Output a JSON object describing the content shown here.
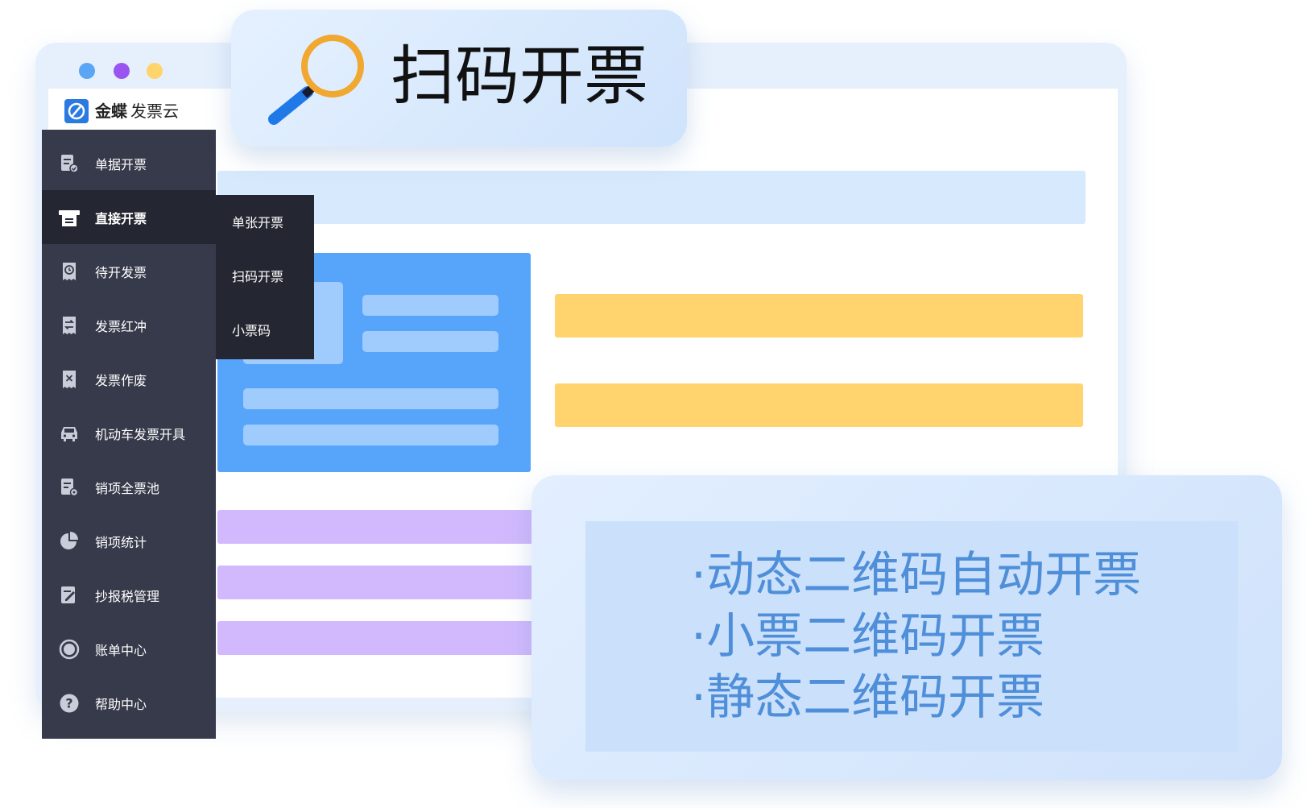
{
  "banner": {
    "title": "扫码开票"
  },
  "app": {
    "logo_brand": "金蝶",
    "logo_product": "发票云"
  },
  "sidebar": {
    "items": [
      {
        "label": "单据开票",
        "icon": "document-check-icon"
      },
      {
        "label": "直接开票",
        "icon": "printer-icon",
        "active": true
      },
      {
        "label": "待开发票",
        "icon": "clock-receipt-icon"
      },
      {
        "label": "发票红冲",
        "icon": "swap-receipt-icon"
      },
      {
        "label": "发票作废",
        "icon": "void-receipt-icon"
      },
      {
        "label": "机动车发票开具",
        "icon": "car-icon"
      },
      {
        "label": "销项全票池",
        "icon": "document-gear-icon"
      },
      {
        "label": "销项统计",
        "icon": "pie-chart-icon"
      },
      {
        "label": "抄报税管理",
        "icon": "edit-document-icon"
      },
      {
        "label": "账单中心",
        "icon": "circle-icon"
      },
      {
        "label": "帮助中心",
        "icon": "help-icon"
      }
    ]
  },
  "submenu": {
    "items": [
      "单张开票",
      "扫码开票",
      "小票码"
    ]
  },
  "features": [
    "·动态二维码自动开票",
    "·小票二维码开票",
    "·静态二维码开票"
  ],
  "colors": {
    "sidebar_bg": "#363a4a",
    "sidebar_active_bg": "#242731",
    "accent_blue": "#57a5fb",
    "accent_yellow": "#ffd46e",
    "accent_purple": "#d2b9fd",
    "feature_text": "#4f8fd9",
    "magnifier_ring": "#f0a830",
    "magnifier_handle": "#1f7ae8"
  }
}
